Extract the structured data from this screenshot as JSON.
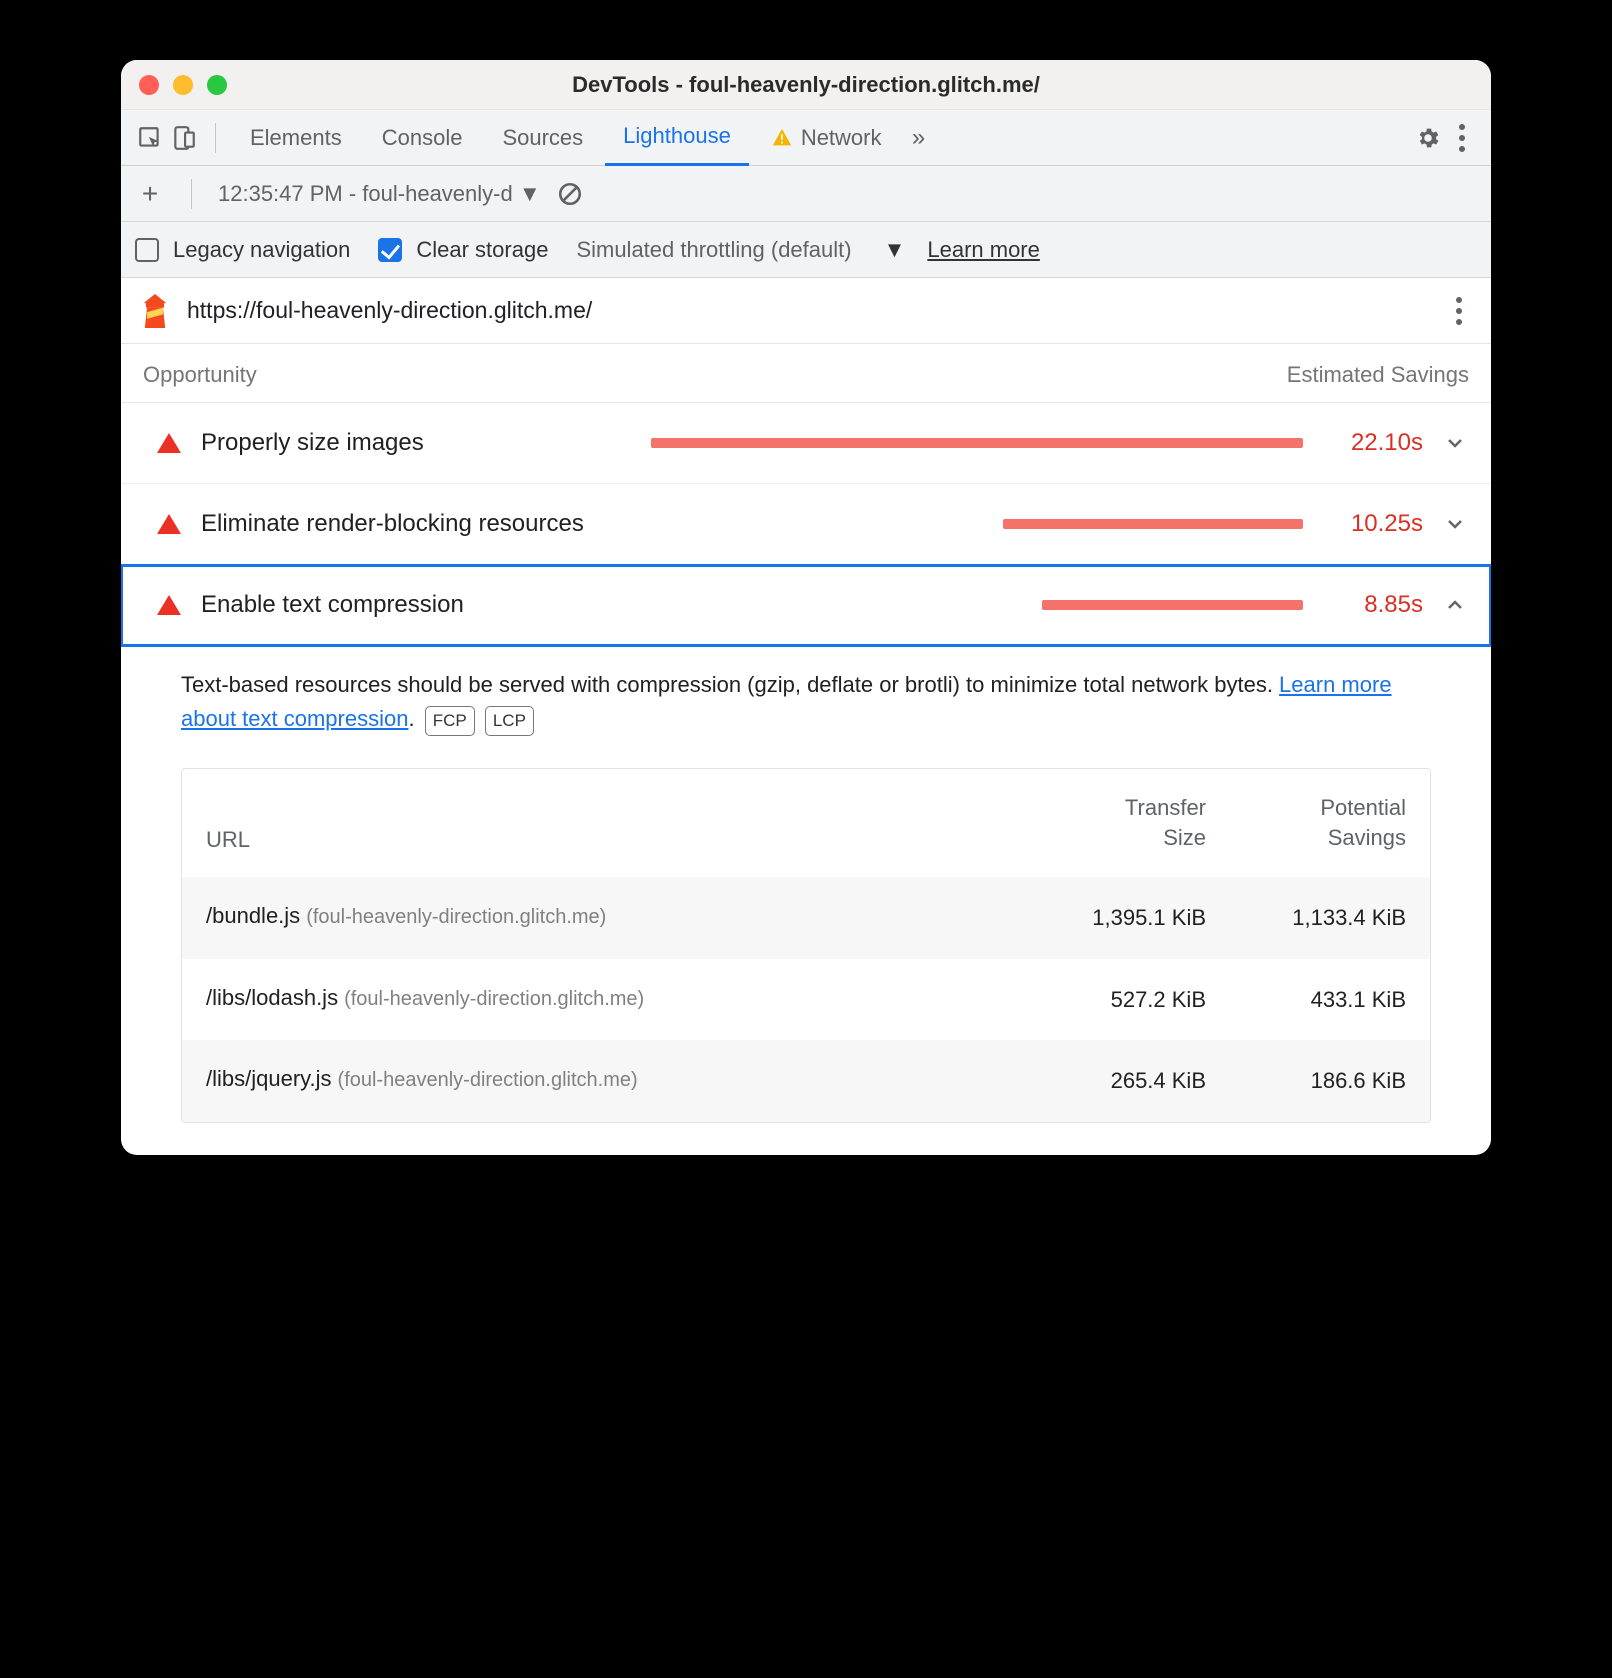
{
  "window": {
    "title": "DevTools - foul-heavenly-direction.glitch.me/"
  },
  "tabs": {
    "elements": "Elements",
    "console": "Console",
    "sources": "Sources",
    "lighthouse": "Lighthouse",
    "network": "Network"
  },
  "toolbar2": {
    "timestamp": "12:35:47 PM - foul-heavenly-d"
  },
  "toolbar3": {
    "legacy": "Legacy navigation",
    "clear": "Clear storage",
    "throttling": "Simulated throttling (default)",
    "learn": "Learn more"
  },
  "site": {
    "url": "https://foul-heavenly-direction.glitch.me/"
  },
  "opsHead": {
    "left": "Opportunity",
    "right": "Estimated Savings"
  },
  "ops": [
    {
      "label": "Properly size images",
      "time": "22.10s",
      "barPct": 100,
      "expanded": false
    },
    {
      "label": "Eliminate render-blocking resources",
      "time": "10.25s",
      "barPct": 46,
      "expanded": false
    },
    {
      "label": "Enable text compression",
      "time": "8.85s",
      "barPct": 40,
      "expanded": true
    }
  ],
  "desc": {
    "text1": "Text-based resources should be served with compression (gzip, deflate or brotli) to minimize total network bytes. ",
    "link": "Learn more about text compression",
    "dot": ".",
    "badge1": "FCP",
    "badge2": "LCP"
  },
  "tableHead": {
    "url": "URL",
    "ts1": "Transfer",
    "ts2": "Size",
    "ps1": "Potential",
    "ps2": "Savings"
  },
  "rows": [
    {
      "path": "/bundle.js",
      "host": "(foul-heavenly-direction.glitch.me)",
      "ts": "1,395.1 KiB",
      "ps": "1,133.4 KiB"
    },
    {
      "path": "/libs/lodash.js",
      "host": "(foul-heavenly-direction.glitch.me)",
      "ts": "527.2 KiB",
      "ps": "433.1 KiB"
    },
    {
      "path": "/libs/jquery.js",
      "host": "(foul-heavenly-direction.glitch.me)",
      "ts": "265.4 KiB",
      "ps": "186.6 KiB"
    }
  ]
}
